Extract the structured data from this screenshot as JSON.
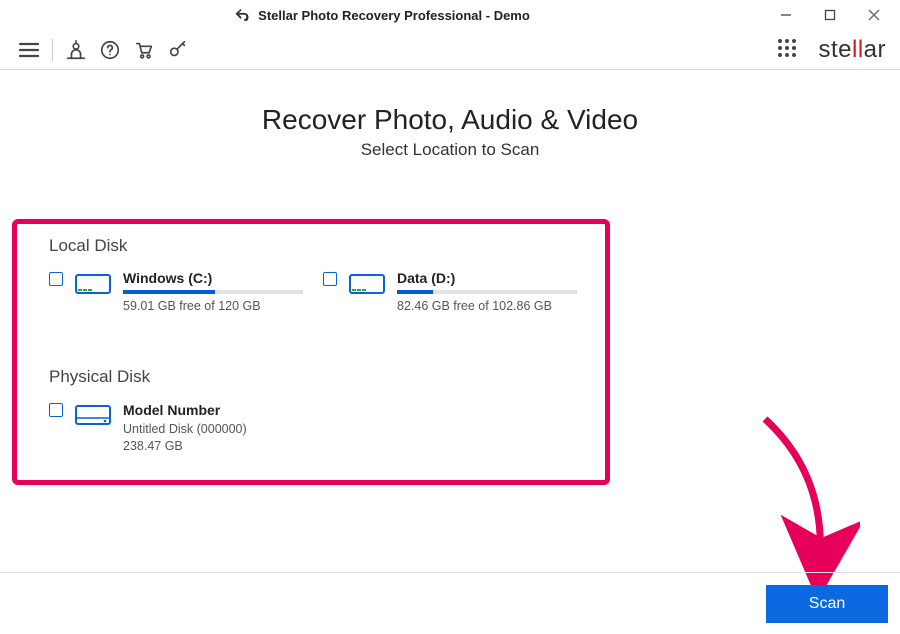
{
  "window": {
    "title": "Stellar Photo Recovery Professional - Demo"
  },
  "brand": {
    "pre": "ste",
    "accent": "ll",
    "post": "ar"
  },
  "headline": {
    "title": "Recover Photo, Audio & Video",
    "subtitle": "Select Location to Scan"
  },
  "sections": {
    "local": {
      "title": "Local Disk",
      "disks": [
        {
          "name": "Windows (C:)",
          "free_text": "59.01 GB free of 120 GB",
          "used_pct": 51
        },
        {
          "name": "Data (D:)",
          "free_text": "82.46 GB free of 102.86 GB",
          "used_pct": 20
        }
      ]
    },
    "physical": {
      "title": "Physical Disk",
      "disks": [
        {
          "model": "Model Number",
          "subtitle": "Untitled Disk (000000)",
          "capacity": "238.47 GB"
        }
      ]
    }
  },
  "actions": {
    "scan": "Scan"
  },
  "colors": {
    "highlight_border": "#e6005a",
    "primary_button": "#0a68e0",
    "progress_fill": "#005dd6"
  }
}
